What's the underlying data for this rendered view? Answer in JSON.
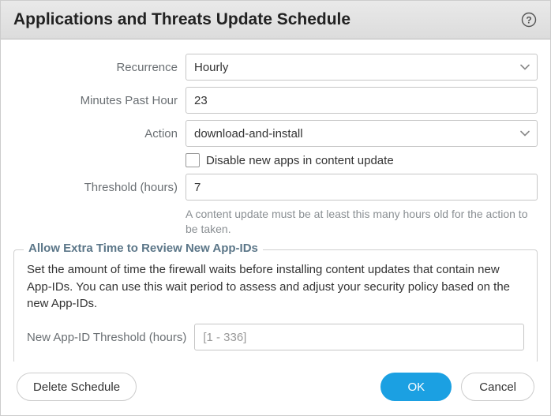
{
  "title": "Applications and Threats Update Schedule",
  "form": {
    "recurrence": {
      "label": "Recurrence",
      "value": "Hourly"
    },
    "minutesPastHour": {
      "label": "Minutes Past Hour",
      "value": "23"
    },
    "action": {
      "label": "Action",
      "value": "download-and-install"
    },
    "disableNewApps": {
      "label": "Disable new apps in content update",
      "checked": false
    },
    "threshold": {
      "label": "Threshold (hours)",
      "value": "7",
      "helper": "A content update must be at least this many hours old for the action to be taken."
    }
  },
  "extraTime": {
    "legend": "Allow Extra Time to Review New App-IDs",
    "description": "Set the amount of time the firewall waits before installing content updates that contain new App-IDs. You can use this wait period to assess and adjust your security policy based on the new App-IDs.",
    "newAppIdThreshold": {
      "label": "New App-ID Threshold (hours)",
      "placeholder": "[1 - 336]",
      "value": ""
    }
  },
  "buttons": {
    "delete": "Delete Schedule",
    "ok": "OK",
    "cancel": "Cancel"
  }
}
